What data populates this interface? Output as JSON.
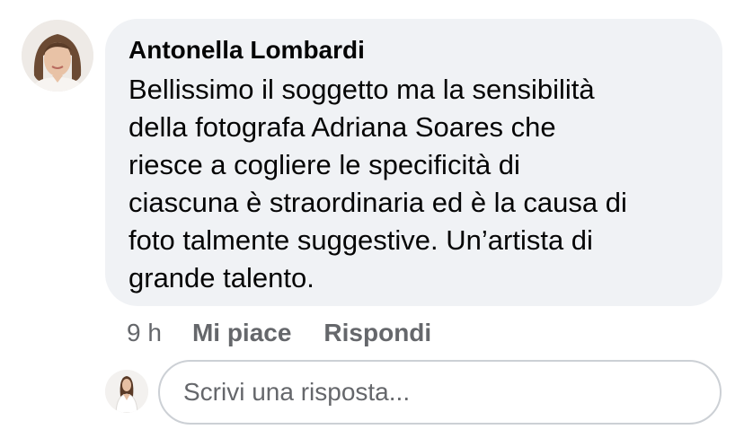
{
  "comment": {
    "author": "Antonella Lombardi",
    "text": "Bellissimo il soggetto ma la sensibilità\ndella fotografa Adriana Soares che\nriesce a cogliere le specificità di\nciascuna è straordinaria ed è la causa di\nfoto talmente suggestive. Un’artista di\ngrande talento.",
    "time": "9 h",
    "like_label": "Mi piace",
    "reply_label": "Rispondi"
  },
  "reply": {
    "placeholder": "Scrivi una risposta..."
  },
  "colors": {
    "bubble_bg": "#f0f2f5",
    "secondary_text": "#65676b",
    "primary_text": "#050505",
    "input_border": "#ccd0d5"
  }
}
